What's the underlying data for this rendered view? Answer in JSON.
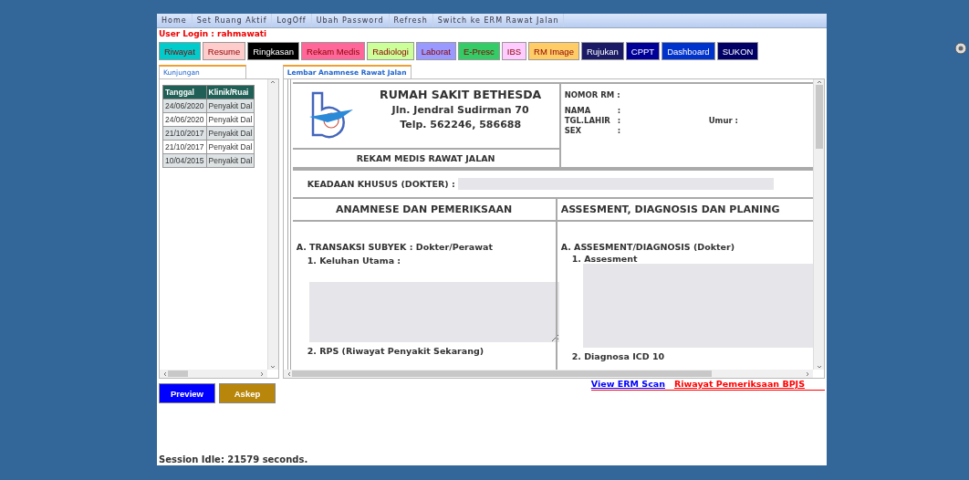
{
  "menu": [
    "Home",
    "Set Ruang Aktif",
    "LogOff",
    "Ubah Password",
    "Refresh",
    "Switch ke ERM Rawat Jalan"
  ],
  "user_login": "User Login : rahmawati",
  "tabs": [
    {
      "label": "Riwayat",
      "color": "#00cccc"
    },
    {
      "label": "Resume",
      "color": "#ffcccc"
    },
    {
      "label": "Ringkasan",
      "color": "#000000"
    },
    {
      "label": "Rekam Medis",
      "color": "#ff6699"
    },
    {
      "label": "Radiologi",
      "color": "#ccff99"
    },
    {
      "label": "Laborat",
      "color": "#9999ff"
    },
    {
      "label": "E-Presc",
      "color": "#33cc66"
    },
    {
      "label": "IBS",
      "color": "#ffccff"
    },
    {
      "label": "RM Image",
      "color": "#ffcc66"
    },
    {
      "label": "Rujukan",
      "color": "#1a1a66"
    },
    {
      "label": "CPPT",
      "color": "#000099"
    },
    {
      "label": "Dashboard",
      "color": "#0033cc"
    },
    {
      "label": "SUKON",
      "color": "#000066"
    }
  ],
  "left_panel": {
    "tab": "Kunjungan",
    "columns": [
      "Tanggal",
      "Klinik/Ruai"
    ],
    "rows": [
      [
        "24/06/2020",
        "Penyakit Dal"
      ],
      [
        "24/06/2020",
        "Penyakit Dal"
      ],
      [
        "21/10/2017",
        "Penyakit Dal"
      ],
      [
        "21/10/2017",
        "Penyakit Dal"
      ],
      [
        "10/04/2015",
        "Penyakit Dal"
      ]
    ]
  },
  "main_panel": {
    "tab": "Lembar Anamnese Rawat Jalan",
    "hospital": {
      "name": "RUMAH SAKIT BETHESDA",
      "address": "Jln. Jendral Sudirman 70",
      "phone": "Telp. 562246, 586688"
    },
    "form_title": "REKAM MEDIS RAWAT JALAN",
    "patient": [
      {
        "label": "NOMOR RM :"
      },
      {
        "label": "NAMA",
        "sep": ":"
      },
      {
        "label": "TGL.LAHIR",
        "sep": ":",
        "extra": "Umur :"
      },
      {
        "label": "SEX",
        "sep": ":"
      }
    ],
    "special_label": "KEADAAN KHUSUS (DOKTER) :",
    "sections": [
      "ANAMNESE DAN PEMERIKSAAN",
      "ASSESMENT, DIAGNOSIS DAN PLANING"
    ],
    "left_column": {
      "heading": "A. TRANSAKSI SUBYEK : Dokter/Perawat",
      "item": "1.  Keluhan Utama :",
      "next": "2. RPS (Riwayat Penyakit Sekarang)"
    },
    "right_column": {
      "heading": "A. ASSESMENT/DIAGNOSIS (Dokter)",
      "item": "1. Assesment",
      "next": "2. Diagnosa ICD 10"
    }
  },
  "buttons": [
    {
      "label": "Preview",
      "color": "#0000ff"
    },
    {
      "label": "Askep",
      "color": "#b8860b"
    }
  ],
  "links": [
    {
      "label": "View ERM Scan",
      "color": "#0000ff"
    },
    {
      "label": "Riwayat Pemeriksaan BPJS",
      "color": "#ff0000"
    }
  ],
  "session": "Session Idle: 21579 seconds."
}
